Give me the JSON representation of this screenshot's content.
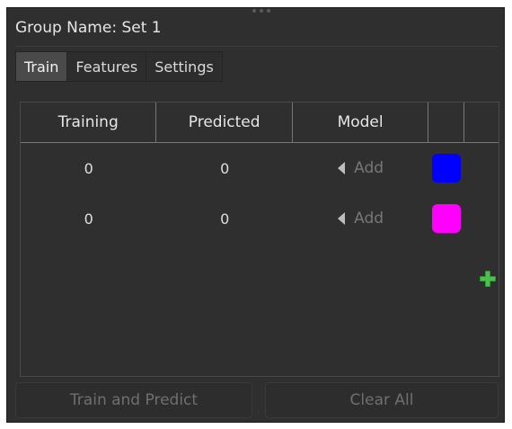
{
  "header": {
    "group_title": "Group Name: Set 1"
  },
  "tabs": [
    {
      "label": "Train",
      "active": true
    },
    {
      "label": "Features",
      "active": false
    },
    {
      "label": "Settings",
      "active": false
    }
  ],
  "table": {
    "columns": [
      "Training",
      "Predicted",
      "Model",
      "",
      ""
    ],
    "rows": [
      {
        "training": "0",
        "predicted": "0",
        "model_action": "Add",
        "color": "#0000ff"
      },
      {
        "training": "0",
        "predicted": "0",
        "model_action": "Add",
        "color": "#ff00ff"
      }
    ]
  },
  "actions": {
    "train_predict_label": "Train and Predict",
    "clear_all_label": "Clear All"
  },
  "icons": {
    "add_row": "plus-icon",
    "model_dropdown": "caret-left-icon",
    "panel_grip": "grip-icon"
  },
  "colors": {
    "panel_bg": "#2f2f2f",
    "plus_green": "#2f9a32"
  }
}
